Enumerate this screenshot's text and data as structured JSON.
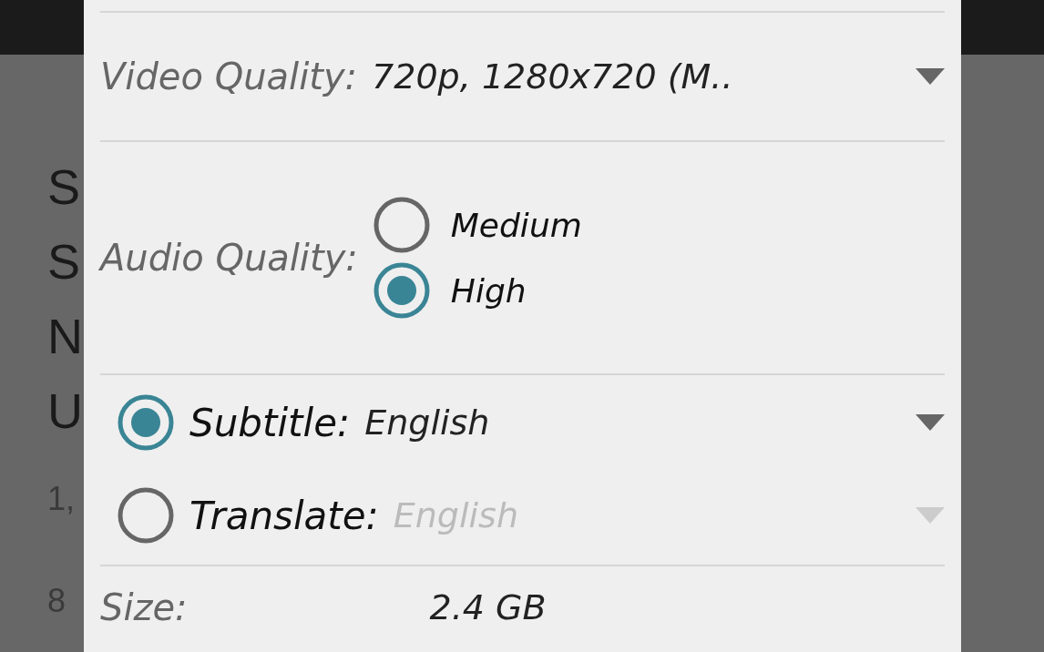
{
  "background_list": {
    "letters": [
      "S",
      "S",
      "N",
      "U",
      "1,",
      "8"
    ]
  },
  "dialog": {
    "video_quality": {
      "label": "Video Quality:",
      "value": "720p, 1280x720 (M.."
    },
    "audio_quality": {
      "label": "Audio Quality:",
      "options": [
        {
          "label": "Medium",
          "selected": false
        },
        {
          "label": "High",
          "selected": true
        }
      ]
    },
    "caption_options": [
      {
        "label": "Subtitle:",
        "value": "English",
        "selected": true
      },
      {
        "label": "Translate:",
        "value": "English",
        "selected": false
      }
    ],
    "size": {
      "label": "Size:",
      "value": "2.4 GB"
    }
  }
}
